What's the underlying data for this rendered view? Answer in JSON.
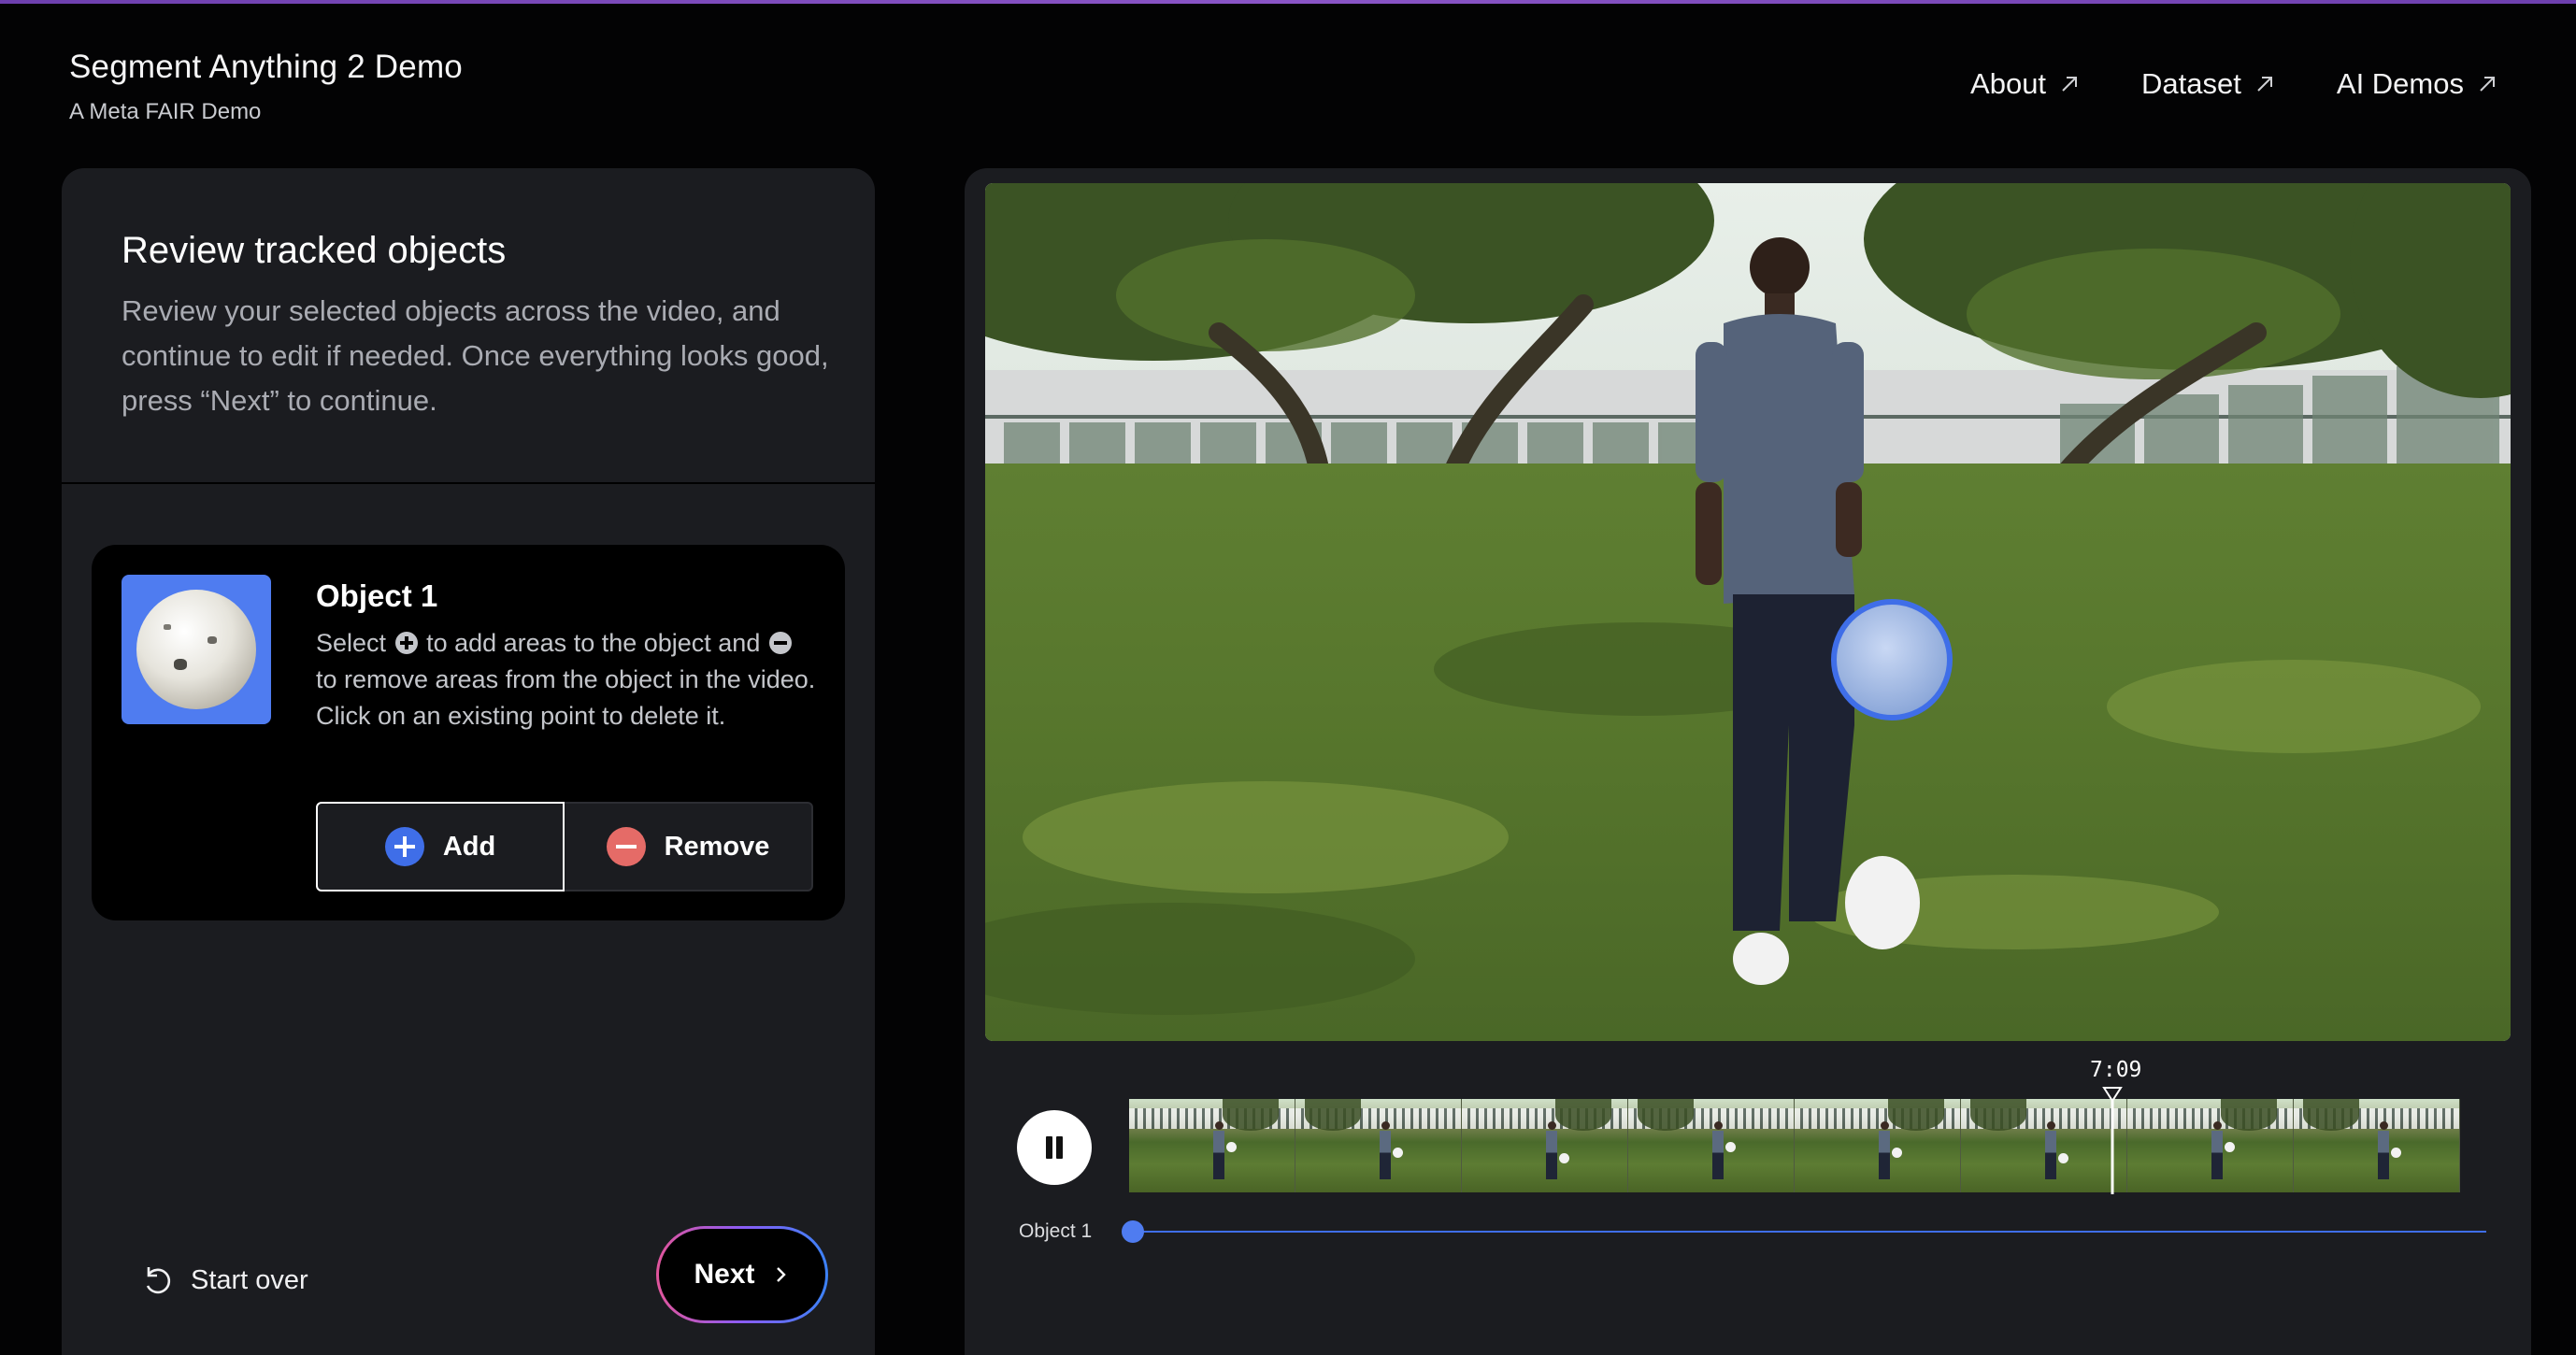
{
  "header": {
    "title": "Segment Anything 2 Demo",
    "subtitle": "A Meta FAIR Demo",
    "nav": [
      {
        "label": "About",
        "icon": "external-arrow-icon"
      },
      {
        "label": "Dataset",
        "icon": "external-arrow-icon"
      },
      {
        "label": "AI Demos",
        "icon": "external-arrow-icon"
      }
    ]
  },
  "step": {
    "title": "Review tracked objects",
    "description": "Review your selected objects across the video, and continue to edit if needed. Once everything looks good, press “Next” to continue."
  },
  "object": {
    "title": "Object 1",
    "help_part1": "Select",
    "help_part2": "to add areas to the object and",
    "help_part3": "to remove areas from the object in the video. Click on an existing point to delete it.",
    "add_label": "Add",
    "remove_label": "Remove"
  },
  "footer": {
    "start_over_label": "Start over",
    "next_label": "Next"
  },
  "timeline": {
    "time": "7:09",
    "track_label": "Object 1",
    "frame_count": 8
  },
  "colors": {
    "accent_blue": "#3f6ee8",
    "remove_red": "#e56b67",
    "panel": "#1b1c20",
    "background": "#030304"
  }
}
